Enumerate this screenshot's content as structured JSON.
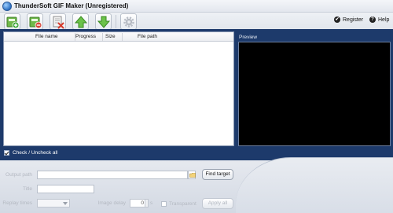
{
  "window": {
    "title": "ThunderSoft GIF Maker (Unregistered)"
  },
  "toolbar": {
    "buttons": [
      {
        "icon": "add-file-icon"
      },
      {
        "icon": "remove-file-icon"
      },
      {
        "icon": "clear-list-icon"
      },
      {
        "icon": "move-up-icon"
      },
      {
        "icon": "move-down-icon"
      },
      {
        "icon": "settings-icon"
      }
    ]
  },
  "header_links": {
    "register": "Register",
    "help": "Help"
  },
  "file_list": {
    "columns": [
      "File name",
      "Progress",
      "Size",
      "File path"
    ],
    "rows": []
  },
  "preview": {
    "label": "Preview"
  },
  "check_all": {
    "label": "Check / Uncheck all",
    "checked": true
  },
  "options": {
    "output_path_label": "Output path",
    "output_path_value": "",
    "find_target_label": "Find target",
    "title_label": "Title",
    "title_value": "",
    "replay_times_label": "Replay times",
    "replay_times_value": "",
    "image_delay_label": "Image delay",
    "image_delay_value": "0",
    "image_delay_unit": "s",
    "transparent_label": "Transparent",
    "transparent_checked": false,
    "apply_all_label": "Apply all"
  },
  "colors": {
    "panel_navy": "#1d3a6b",
    "preview_bg": "#000000",
    "disabled_text": "#b4b9c2"
  }
}
